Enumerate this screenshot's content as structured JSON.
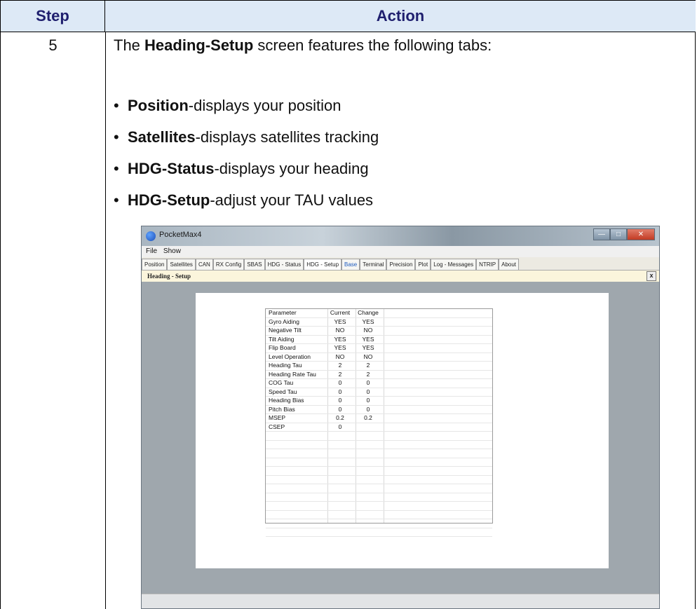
{
  "table_header": {
    "step": "Step",
    "action": "Action"
  },
  "row": {
    "step": "5",
    "intro_pre": "The ",
    "intro_bold": "Heading-Setup",
    "intro_post": " screen features the following tabs:",
    "bullets": [
      {
        "bold": "Position",
        "text": "-displays your position"
      },
      {
        "bold": "Satellites",
        "text": "-displays satellites tracking"
      },
      {
        "bold": "HDG-Status",
        "text": "-displays your heading"
      },
      {
        "bold": "HDG-Setup",
        "text": "-adjust your TAU values"
      }
    ]
  },
  "app": {
    "title": "PocketMax4",
    "menu": [
      "File",
      "Show"
    ],
    "tabs": [
      "Position",
      "Satellites",
      "CAN",
      "RX Config",
      "SBAS",
      "HDG - Status",
      "HDG - Setup",
      "Base",
      "Terminal",
      "Precision",
      "Plot",
      "Log - Messages",
      "NTRIP",
      "About"
    ],
    "selected_tab": "HDG - Setup",
    "panel_title": "Heading - Setup",
    "close_label": "x",
    "grid": {
      "headers": [
        "Parameter",
        "Current",
        "Change"
      ],
      "rows": [
        [
          "Gyro Aiding",
          "YES",
          "YES"
        ],
        [
          "Negative Tilt",
          "NO",
          "NO"
        ],
        [
          "Tilt Aiding",
          "YES",
          "YES"
        ],
        [
          "Flip Board",
          "YES",
          "YES"
        ],
        [
          "Level Operation",
          "NO",
          "NO"
        ],
        [
          "Heading Tau",
          "2",
          "2"
        ],
        [
          "Heading Rate Tau",
          "2",
          "2"
        ],
        [
          "COG Tau",
          "0",
          "0"
        ],
        [
          "Speed Tau",
          "0",
          "0"
        ],
        [
          "Heading Bias",
          "0",
          "0"
        ],
        [
          "Pitch Bias",
          "0",
          "0"
        ],
        [
          "MSEP",
          "0.2",
          "0.2"
        ],
        [
          "CSEP",
          "0",
          ""
        ]
      ]
    }
  }
}
